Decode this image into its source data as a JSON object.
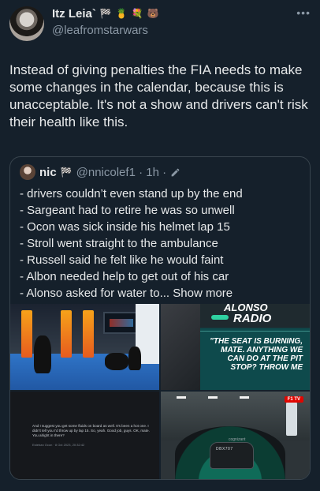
{
  "author": {
    "display_name": "Itz Leia`",
    "handle": "@leafromstarwars",
    "name_emojis": [
      "🏁",
      "🍍",
      "💐",
      "🐻"
    ]
  },
  "tweet": {
    "text": "Instead of giving penalties the FIA needs to make some changes in the calendar, because this is unacceptable. It's not a show and drivers can't risk their health like this."
  },
  "quote": {
    "author_name": "nic",
    "author_emoji": "🏁",
    "handle_time": "@nnicolef1 · 1h ·",
    "lines": [
      "- drivers couldn’t even stand up by the end",
      "- Sargeant had to retire he was so unwell",
      "- Ocon was sick inside his helmet lap 15",
      "- Stroll went straight to the ambulance",
      "- Russell said he felt like he would faint",
      "- Albon needed help to get out of his car"
    ],
    "last_line": "- Alonso asked for water to...",
    "show_more": "Show more",
    "media": {
      "radio_title_top": "ALONSO",
      "radio_title": "RADIO",
      "radio_quote": "\"THE SEAT IS BURNING, MATE. ANYTHING WE CAN DO AT THE PIT STOP? THROW ME",
      "transcript": "And I suggest you get some fluids on board as well. It's been a hot one. I didn't tell you I'd throw up by lap 15. So, yeah. Good job, guys. OK, mate. You alright in there?",
      "transcript_meta": "Esteban Ocon · 8 Oct 2023, 20:32:42",
      "onboard_number": "DBX707",
      "onboard_sponsor": "cognizant",
      "onboard_badge": "F1 TV"
    }
  },
  "icons": {
    "more": "more-dots-icon",
    "edit": "pencil-icon"
  },
  "colors": {
    "background": "#15202b",
    "text": "#e7e9ea",
    "secondary": "#8b98a5",
    "border": "#38444d"
  }
}
